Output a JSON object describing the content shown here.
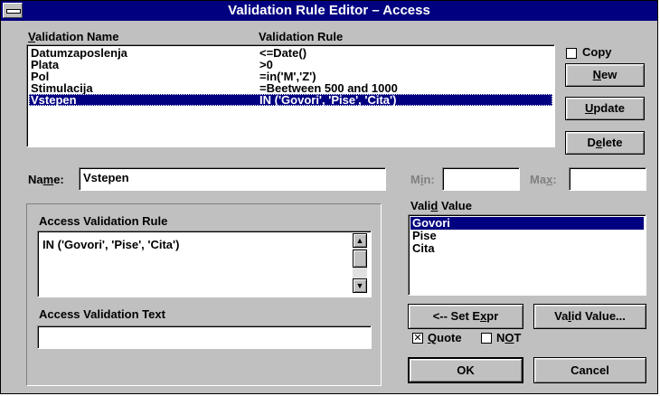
{
  "window": {
    "title": "Validation Rule Editor – Access"
  },
  "list": {
    "col_name_prefix": "",
    "col_name_mnemonic": "V",
    "col_name_rest": "alidation Name",
    "col_rule": "Validation Rule",
    "rows": [
      {
        "name": "Datumzaposlenja",
        "rule": "<=Date()"
      },
      {
        "name": "Plata",
        "rule": ">0"
      },
      {
        "name": "Pol",
        "rule": "=in('M','Z')"
      },
      {
        "name": "Stimulacija",
        "rule": "=Beetween 500 and 1000"
      },
      {
        "name": "Vstepen",
        "rule": "IN ('Govori', 'Pise', 'Cita')"
      }
    ],
    "selected_index": 4
  },
  "buttons": {
    "copy_label": "Copy",
    "new_mnemonic": "N",
    "new_rest": "ew",
    "update_mnemonic": "U",
    "update_rest": "pdate",
    "delete_prefix": "D",
    "delete_mnemonic": "e",
    "delete_rest": "lete",
    "set_expr_prefix": "<-- Set E",
    "set_expr_mnemonic": "x",
    "set_expr_rest": "pr",
    "valid_value_prefix": "Va",
    "valid_value_mnemonic": "l",
    "valid_value_rest": "id Value...",
    "ok": "OK",
    "cancel": "Cancel"
  },
  "name_field": {
    "label_prefix": "Na",
    "label_mnemonic": "m",
    "label_rest": "e:",
    "value": "Vstepen"
  },
  "min_field": {
    "label_prefix": "M",
    "label_mnemonic": "i",
    "label_rest": "n:",
    "value": ""
  },
  "max_field": {
    "label_prefix": "Ma",
    "label_mnemonic": "x",
    "label_rest": ":",
    "value": ""
  },
  "access_rule": {
    "heading": "Access Validation Rule",
    "text": "IN ('Govori', 'Pise', 'Cita')"
  },
  "access_text": {
    "heading": "Access Validation Text",
    "value": ""
  },
  "valid_values": {
    "label_prefix": "Vali",
    "label_mnemonic": "d",
    "label_rest": " Value",
    "items": [
      "Govori",
      "Pise",
      "Cita"
    ],
    "selected_index": 0
  },
  "options": {
    "quote_mnemonic": "Q",
    "quote_rest": "uote",
    "quote_checked": true,
    "not_prefix": "N",
    "not_mnemonic": "O",
    "not_rest": "T",
    "not_checked": false
  },
  "icons": {
    "system_menu": "system-menu-icon",
    "scroll_up": "arrow-up-icon",
    "scroll_down": "arrow-down-icon"
  },
  "colors": {
    "title_bar": "#000080",
    "selection": "#000080",
    "face": "#c0c0c0"
  }
}
